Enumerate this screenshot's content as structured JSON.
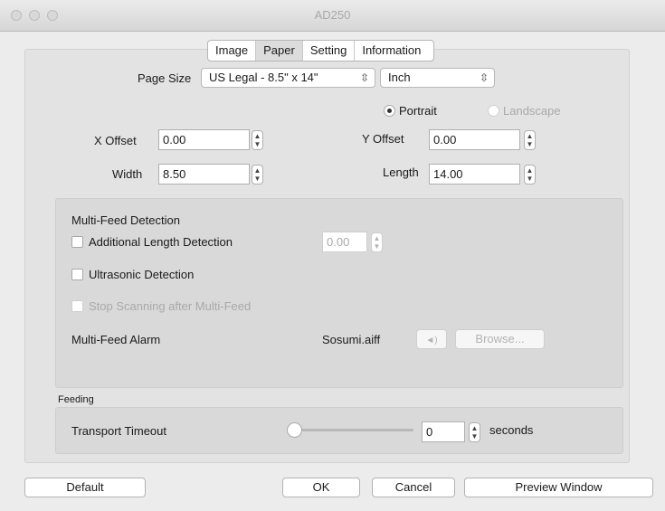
{
  "window": {
    "title": "AD250"
  },
  "tabs": [
    {
      "label": "Image",
      "active": false
    },
    {
      "label": "Paper",
      "active": true
    },
    {
      "label": "Setting",
      "active": false
    },
    {
      "label": "Information",
      "active": false
    }
  ],
  "page_size": {
    "label": "Page Size",
    "value": "US Legal - 8.5\" x 14\"",
    "unit": "Inch"
  },
  "orientation": {
    "portrait": "Portrait",
    "landscape": "Landscape",
    "selected": "Portrait"
  },
  "x_offset": {
    "label": "X Offset",
    "value": "0.00"
  },
  "y_offset": {
    "label": "Y Offset",
    "value": "0.00"
  },
  "width": {
    "label": "Width",
    "value": "8.50"
  },
  "length": {
    "label": "Length",
    "value": "14.00"
  },
  "multifeed": {
    "heading": "Multi-Feed Detection",
    "additional_length": {
      "label": "Additional Length Detection",
      "value": "0.00",
      "checked": false
    },
    "ultrasonic": {
      "label": "Ultrasonic Detection",
      "checked": false
    },
    "stop_scanning": {
      "label": "Stop Scanning after Multi-Feed",
      "checked": false
    },
    "alarm": {
      "label": "Multi-Feed Alarm",
      "file": "Sosumi.aiff",
      "browse": "Browse..."
    }
  },
  "feeding": {
    "heading": "Feeding",
    "transport_timeout": {
      "label": "Transport Timeout",
      "value": "0",
      "unit": "seconds",
      "slider_fraction": 0
    }
  },
  "buttons": {
    "default": "Default",
    "ok": "OK",
    "cancel": "Cancel",
    "preview": "Preview Window"
  }
}
